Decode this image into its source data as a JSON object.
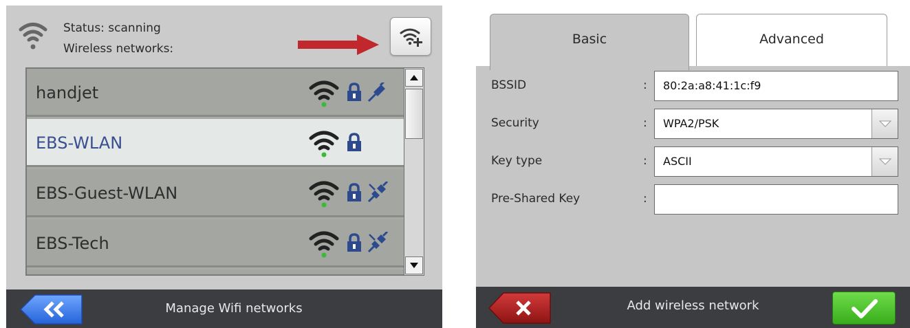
{
  "left_panel": {
    "status_line": "Status: scanning",
    "networks_label": "Wireless networks:",
    "footer_title": "Manage Wifi networks",
    "networks": [
      {
        "name": "handjet",
        "secured": true,
        "connection": "connected",
        "signal": "full"
      },
      {
        "name": "EBS-WLAN",
        "secured": true,
        "connection": "none",
        "signal": "full",
        "selected": true
      },
      {
        "name": "EBS-Guest-WLAN",
        "secured": true,
        "connection": "disconnected",
        "signal": "full"
      },
      {
        "name": "EBS-Tech",
        "secured": true,
        "connection": "disconnected",
        "signal": "full"
      }
    ]
  },
  "right_panel": {
    "tabs": [
      {
        "label": "Basic",
        "active": true
      },
      {
        "label": "Advanced",
        "active": false
      }
    ],
    "fields": [
      {
        "label": "BSSID",
        "value": "80:2a:a8:41:1c:f9",
        "type": "text"
      },
      {
        "label": "Security",
        "value": "WPA2/PSK",
        "type": "select"
      },
      {
        "label": "Key type",
        "value": "ASCII",
        "type": "select"
      },
      {
        "label": "Pre-Shared Key",
        "value": "",
        "type": "text"
      }
    ],
    "colon": ":",
    "footer_title": "Add wireless network"
  },
  "colors": {
    "accent_red": "#c0282d",
    "selected_text": "#3a4f8f",
    "confirm_green": "#4cc52c",
    "signal_dot_green": "#3db93a",
    "lock_blue": "#2e4a8e"
  },
  "icons": [
    "wifi-status-icon",
    "add-wifi-icon",
    "lock-icon",
    "plug-connected-icon",
    "plug-disconnected-icon",
    "back-icon",
    "close-icon",
    "check-icon",
    "chevron-down-icon"
  ]
}
